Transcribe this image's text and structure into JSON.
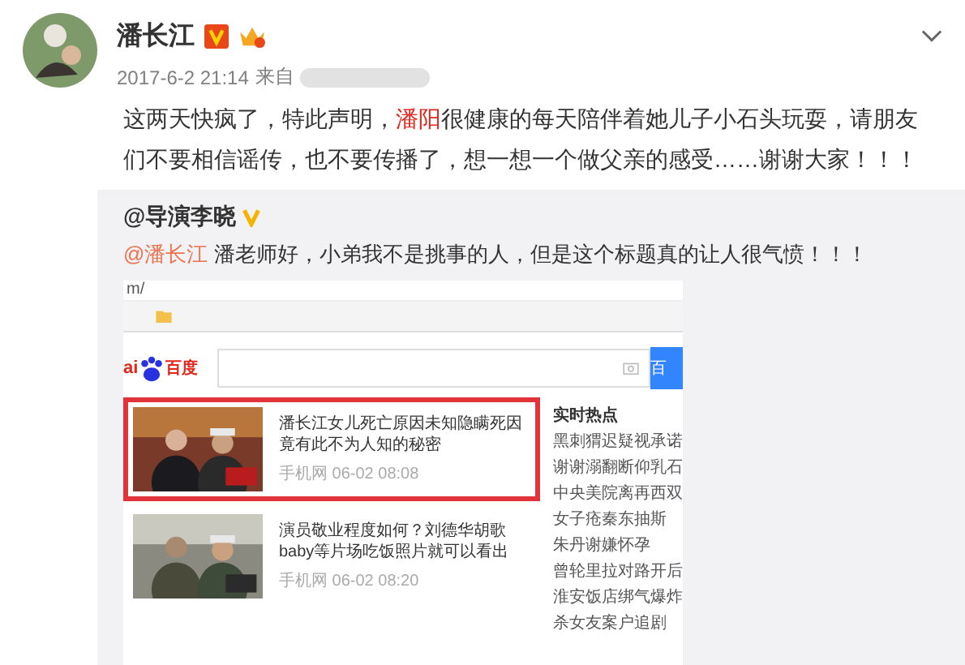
{
  "post": {
    "author": "潘长江",
    "time": "2017-6-2 21:14",
    "source_prefix": "来自",
    "text_before": "这两天快疯了，特此声明，",
    "highlight": "潘阳",
    "text_after": "很健康的每天陪伴着她儿子小石头玩耍，请朋友们不要相信谣传，也不要传播了，想一想一个做父亲的感受……谢谢大家！！！"
  },
  "repost": {
    "author": "@导演李晓",
    "mention": "@潘长江",
    "comment": " 潘老师好，小弟我不是挑事的人，但是这个标题真的让人很气愤！！！",
    "screenshot": {
      "address": "m/",
      "logo_prefix": "ai",
      "logo_text": "百度",
      "button": "百",
      "articles": [
        {
          "headline": "潘长江女儿死亡原因未知隐瞒死因竟有此不为人知的秘密",
          "meta": "手机网  06-02 08:08",
          "selected": true
        },
        {
          "headline": "演员敬业程度如何？刘德华胡歌baby等片场吃饭照片就可以看出",
          "meta": "手机网  06-02 08:20",
          "selected": false
        }
      ],
      "hot_title": "实时热点",
      "hot": [
        "黑刺猬迟疑视承诺",
        "谢谢溺翻断仰乳石",
        "中央美院离再西双",
        "女子疮秦东抽斯",
        "朱丹谢嫌怀孕",
        "曾轮里拉对路开后",
        "淮安饭店绑气爆炸",
        "杀女友案户追剧"
      ]
    }
  }
}
